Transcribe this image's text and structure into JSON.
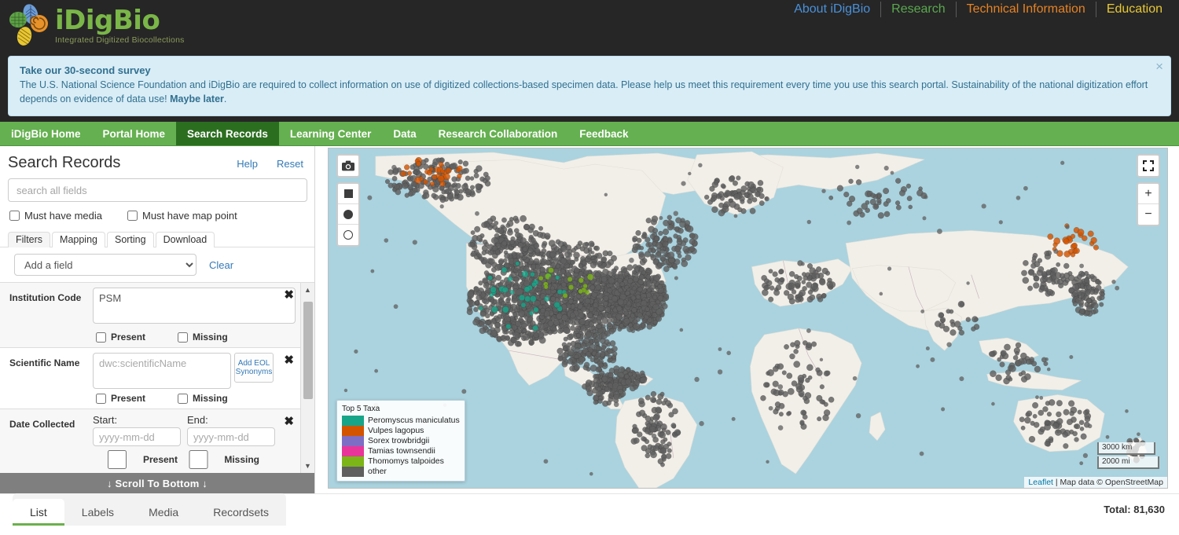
{
  "brand": {
    "name": "iDigBio",
    "tagline": "Integrated Digitized Biocollections",
    "green": "#7ab648"
  },
  "top_nav": {
    "items": [
      {
        "label": "About iDigBio",
        "color": "#4a90d9"
      },
      {
        "label": "Research",
        "color": "#5aa84f"
      },
      {
        "label": "Technical Information",
        "color": "#e58224"
      },
      {
        "label": "Education",
        "color": "#e8c832"
      }
    ]
  },
  "alert": {
    "title": "Take our 30-second survey",
    "body_part1": "The U.S. National Science Foundation and iDigBio are required to collect information on use of digitized collections-based specimen data. Please help us meet this requirement every time you use this search portal. Sustainability of the national digitization effort depends on evidence of data use! ",
    "maybe_later": "Maybe later",
    "body_part2": ".",
    "close_label": "×"
  },
  "green_nav": {
    "items": [
      {
        "label": "iDigBio Home",
        "active": false
      },
      {
        "label": "Portal Home",
        "active": false
      },
      {
        "label": "Search Records",
        "active": true
      },
      {
        "label": "Learning Center",
        "active": false
      },
      {
        "label": "Data",
        "active": false
      },
      {
        "label": "Research Collaboration",
        "active": false
      },
      {
        "label": "Feedback",
        "active": false
      }
    ]
  },
  "sidebar": {
    "title": "Search Records",
    "help_label": "Help",
    "reset_label": "Reset",
    "search_placeholder": "search all fields",
    "search_value": "",
    "checkboxes": [
      {
        "label": "Must have media",
        "checked": false
      },
      {
        "label": "Must have map point",
        "checked": false
      }
    ],
    "tabs": [
      {
        "label": "Filters",
        "active": true
      },
      {
        "label": "Mapping",
        "active": false
      },
      {
        "label": "Sorting",
        "active": false
      },
      {
        "label": "Download",
        "active": false
      }
    ],
    "add_field_label": "Add a field",
    "clear_label": "Clear",
    "present_label": "Present",
    "missing_label": "Missing",
    "filters": [
      {
        "label": "Institution Code",
        "type": "textarea",
        "value": "PSM",
        "placeholder": "",
        "present": false,
        "missing": false,
        "remove_label": "✖"
      },
      {
        "label": "Scientific Name",
        "type": "textarea-eol",
        "value": "",
        "placeholder": "dwc:scientificName",
        "eol_line1": "Add    EOL",
        "eol_line2": "Synonyms",
        "present": false,
        "missing": false,
        "remove_label": "✖"
      },
      {
        "label": "Date Collected",
        "type": "daterange",
        "start_label": "Start:",
        "end_label": "End:",
        "start_placeholder": "yyyy-mm-dd",
        "end_placeholder": "yyyy-mm-dd",
        "start_value": "",
        "end_value": "",
        "present": false,
        "missing": false,
        "remove_label": "✖"
      }
    ],
    "scroll_to_bottom": "↓ Scroll To Bottom ↓"
  },
  "map": {
    "controls": {
      "camera": "camera-icon",
      "square": "square-select-icon",
      "circle_filled": "circle-select-icon",
      "circle_outline": "circle-outline-select-icon",
      "fullscreen": "fullscreen-icon",
      "zoom_in": "+",
      "zoom_out": "−"
    },
    "legend": {
      "title": "Top 5 Taxa",
      "items": [
        {
          "label": "Peromyscus maniculatus",
          "color": "#17a589"
        },
        {
          "label": "Vulpes lagopus",
          "color": "#d35400"
        },
        {
          "label": "Sorex trowbridgii",
          "color": "#7d6dc4"
        },
        {
          "label": "Tamias townsendii",
          "color": "#e8359a"
        },
        {
          "label": "Thomomys talpoides",
          "color": "#7cb518"
        },
        {
          "label": "other",
          "color": "#5f5f5f"
        }
      ]
    },
    "scale": {
      "metric": "3000 km",
      "imperial": "2000 mi"
    },
    "attribution": {
      "leaflet": "Leaflet",
      "separator": " | ",
      "text": "Map data © OpenStreetMap"
    },
    "colors": {
      "ocean": "#aad3df",
      "land": "#f2efe9",
      "border": "#c9b6bd"
    }
  },
  "results": {
    "tabs": [
      {
        "label": "List",
        "active": true
      },
      {
        "label": "Labels",
        "active": false
      },
      {
        "label": "Media",
        "active": false
      },
      {
        "label": "Recordsets",
        "active": false
      }
    ],
    "total_label": "Total: 81,630"
  }
}
